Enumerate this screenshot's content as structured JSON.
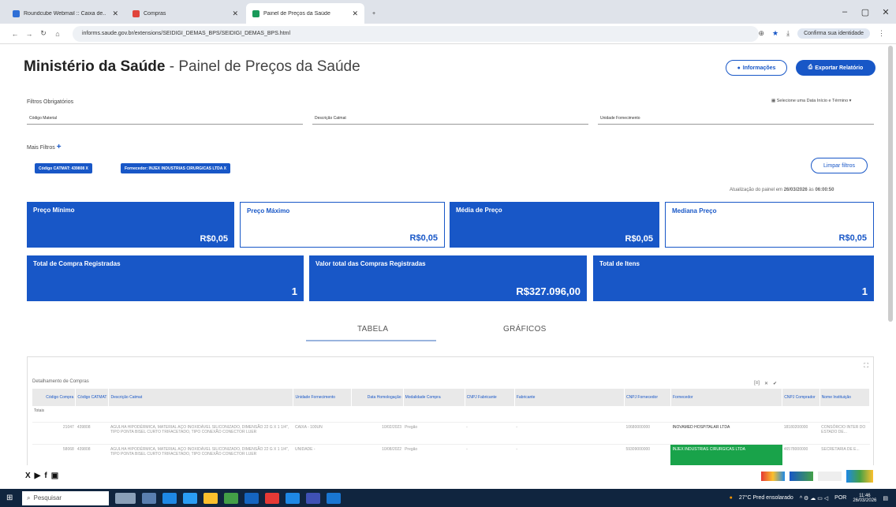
{
  "browser": {
    "tabs": [
      {
        "title": "Roundcube Webmail :: Caixa de...",
        "color": "#2f6fd6"
      },
      {
        "title": "Compras",
        "color": "#e0443c"
      },
      {
        "title": "Painel de Preços da Saúde",
        "color": "#1a9a5a"
      }
    ],
    "url": "informs.saude.gov.br/extensions/SEIDIGI_DEMAS_BPS/SEIDIGI_DEMAS_BPS.html",
    "identity_btn": "Confirma sua identidade"
  },
  "header": {
    "org": "Ministério da Saúde",
    "title": "- Painel de Preços da Saúde",
    "info_btn": "Informações",
    "export_btn": "Exportar Relatório"
  },
  "filters": {
    "label": "Filtros Obrigatórios",
    "date_picker": "Selecione uma Data Início e Término",
    "inputs": [
      "Código Material",
      "Descrição Catmat",
      "Unidade Fornecimento"
    ],
    "more": "Mais Filtros",
    "chips": [
      "Código CATMAT: 439808 X",
      "Fornecedor: INJEX INDUSTRIAS CIRURGICAS LTDA X"
    ],
    "clear_btn": "Limpar filtros"
  },
  "updated": {
    "text": "Atualização do painel em",
    "date": "26/03/2026",
    "at": "às",
    "time": "06:00:50"
  },
  "cards": [
    {
      "label": "Preço Mínimo",
      "value": "R$0,05"
    },
    {
      "label": "Preço Máximo",
      "value": "R$0,05"
    },
    {
      "label": "Média de Preço",
      "value": "R$0,05"
    },
    {
      "label": "Mediana Preço",
      "value": "R$0,05"
    },
    {
      "label": "Total de Compra Registradas",
      "value": "1"
    },
    {
      "label": "Valor total das Compras Registradas",
      "value": "R$327.096,00"
    },
    {
      "label": "Total de Itens",
      "value": "1"
    }
  ],
  "view_tabs": [
    "TABELA",
    "GRÁFICOS"
  ],
  "table": {
    "title": "Detalhamento de Compras",
    "columns": [
      "Código Compra",
      "Código CATMAT",
      "Descrição Catmat",
      "Unidade Fornecimento",
      "Data Homologação",
      "Modalidade Compra",
      "CNPJ Fabricante",
      "Fabricante",
      "CNPJ Fornecedor",
      "Fornecedor",
      "CNPJ Comprador",
      "Nome Instituição"
    ],
    "totals_label": "Totais",
    "rows": [
      [
        "21047",
        "439808",
        "AGULHA HIPODÉRMICA, MATERIAL AÇO INOXIDÁVEL SILICONIZADO, DIMENSÃO 22 G X 1 1/4\", TIPO PONTA BISEL CURTO TRIFACETADO, TIPO CONEXÃO CONECTOR LUER",
        "CAIXA - 100UN",
        "10/02/2023",
        "Pregão",
        "-",
        "-",
        "10680000000",
        "INOVAMED HOSPITALAR LTDA",
        "18180200000",
        "CONSÓRCIO INTER DO ESTADO DE..."
      ],
      [
        "58068",
        "439808",
        "AGULHA HIPODÉRMICA, MATERIAL AÇO INOXIDÁVEL SILICONIZADO, DIMENSÃO 22 G X 1 1/4\", TIPO PONTA BISEL CURTO TRIFACETADO, TIPO CONEXÃO CONECTOR LUER",
        "UNIDADE -",
        "10/08/2022",
        "Pregão",
        "-",
        "-",
        "59309000000",
        "INJEX INDUSTRIAS CIRURGICAS LTDA",
        "46578000000",
        "SECRETARIA DE E..."
      ]
    ]
  },
  "taskbar": {
    "search": "Pesquisar",
    "weather": "27°C Pred ensolarado",
    "lang": "POR",
    "time": "11:46",
    "date": "26/03/2026"
  }
}
